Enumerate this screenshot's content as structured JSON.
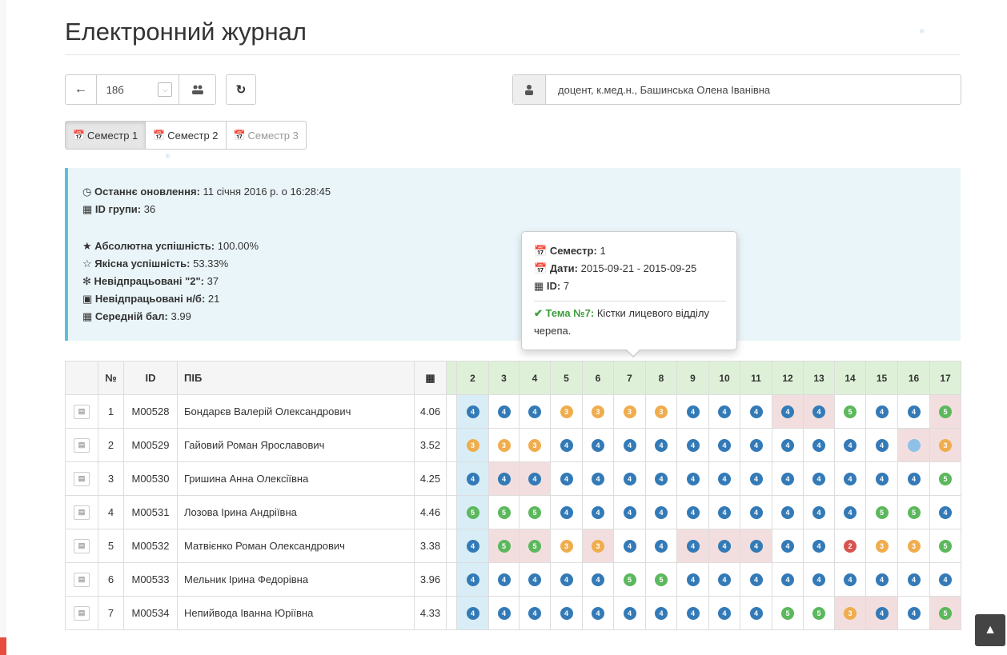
{
  "page": {
    "title": "Електронний журнал"
  },
  "toolbar": {
    "back_icon": "arrow-left-icon",
    "group_value": "18б",
    "group_icon": "users-icon",
    "refresh_icon": "refresh-icon",
    "teacher_icon": "user-icon",
    "teacher_value": "доцент, к.мед.н., Башинська Олена Іванівна"
  },
  "semesters": [
    {
      "label": "Семестр 1",
      "state": "active"
    },
    {
      "label": "Семестр 2",
      "state": "normal"
    },
    {
      "label": "Семестр 3",
      "state": "disabled"
    }
  ],
  "info": {
    "updated_label": "Останнє оновлення:",
    "updated_value": "11 січня 2016 р. о 16:28:45",
    "group_id_label": "ID групи:",
    "group_id_value": "36",
    "abs_label": "Абсолютна успішність:",
    "abs_value": "100.00%",
    "qual_label": "Якісна успішність:",
    "qual_value": "53.33%",
    "unworked2_label": "Невідпрацьовані \"2\":",
    "unworked2_value": "37",
    "unworkednb_label": "Невідпрацьовані н/б:",
    "unworkednb_value": "21",
    "avg_label": "Середній бал:",
    "avg_value": "3.99"
  },
  "popover": {
    "semester_label": "Семестр:",
    "semester_value": "1",
    "dates_label": "Дати:",
    "dates_value": "2015-09-21 - 2015-09-25",
    "id_label": "ID:",
    "id_value": "7",
    "topic_label": "Тема №7:",
    "topic_line1": "Кістки лицевого відділу",
    "topic_line2": "черепа."
  },
  "table": {
    "headers": {
      "num": "№",
      "id": "ID",
      "name": "ПІБ",
      "avg_icon": "calculator-icon"
    },
    "lessons": [
      "2",
      "3",
      "4",
      "5",
      "6",
      "7",
      "8",
      "9",
      "10",
      "11",
      "12",
      "13",
      "14",
      "15",
      "16",
      "17"
    ],
    "rows": [
      {
        "num": "1",
        "id": "M00528",
        "name": "Бондарєв Валерій Олександрович",
        "avg": "4.06",
        "marks": [
          "4",
          "4",
          "4",
          "3",
          "3",
          "3",
          "3",
          "4",
          "4",
          "4",
          "4",
          "4",
          "5",
          "4",
          "4",
          "5"
        ],
        "bad": [
          10,
          11,
          15
        ]
      },
      {
        "num": "2",
        "id": "M00529",
        "name": "Гайовий Роман Ярославович",
        "avg": "3.52",
        "marks": [
          "3",
          "3",
          "3",
          "4",
          "4",
          "4",
          "4",
          "4",
          "4",
          "4",
          "4",
          "4",
          "4",
          "4",
          "",
          "3"
        ],
        "bad": [
          14,
          15
        ]
      },
      {
        "num": "3",
        "id": "M00530",
        "name": "Гришина Анна Олексіївна",
        "avg": "4.25",
        "marks": [
          "4",
          "4",
          "4",
          "4",
          "4",
          "4",
          "4",
          "4",
          "4",
          "4",
          "4",
          "4",
          "4",
          "4",
          "4",
          "5"
        ],
        "bad": [
          1,
          2
        ]
      },
      {
        "num": "4",
        "id": "M00531",
        "name": "Лозова Ірина Андріївна",
        "avg": "4.46",
        "marks": [
          "5",
          "5",
          "5",
          "4",
          "4",
          "4",
          "4",
          "4",
          "4",
          "4",
          "4",
          "4",
          "4",
          "5",
          "5",
          "4"
        ],
        "bad": []
      },
      {
        "num": "5",
        "id": "M00532",
        "name": "Матвієнко Роман Олександрович",
        "avg": "3.38",
        "marks": [
          "4",
          "5",
          "5",
          "3",
          "3",
          "4",
          "4",
          "4",
          "4",
          "4",
          "4",
          "4",
          "2",
          "3",
          "3",
          "5"
        ],
        "bad": [
          1,
          2,
          4,
          7,
          8,
          9
        ]
      },
      {
        "num": "6",
        "id": "M00533",
        "name": "Мельник Ірина Федорівна",
        "avg": "3.96",
        "marks": [
          "4",
          "4",
          "4",
          "4",
          "4",
          "5",
          "5",
          "4",
          "4",
          "4",
          "4",
          "4",
          "4",
          "4",
          "4",
          "4"
        ],
        "bad": []
      },
      {
        "num": "7",
        "id": "M00534",
        "name": "Непийвода Іванна Юріївна",
        "avg": "4.33",
        "marks": [
          "4",
          "4",
          "4",
          "4",
          "4",
          "4",
          "4",
          "4",
          "4",
          "4",
          "5",
          "5",
          "3",
          "4",
          "4",
          "5"
        ],
        "bad": [
          12,
          13,
          15
        ]
      }
    ]
  },
  "colors": {
    "mark2": "#d9534f",
    "mark3": "#f0ad4e",
    "mark4": "#337ab7",
    "mark5": "#5cb85c",
    "info_bg": "#eaf5f9",
    "info_border": "#5bc0de",
    "lesson_header": "#dff0d8",
    "bad_cell": "#f2dede",
    "highlight_col": "#d9edf7"
  }
}
